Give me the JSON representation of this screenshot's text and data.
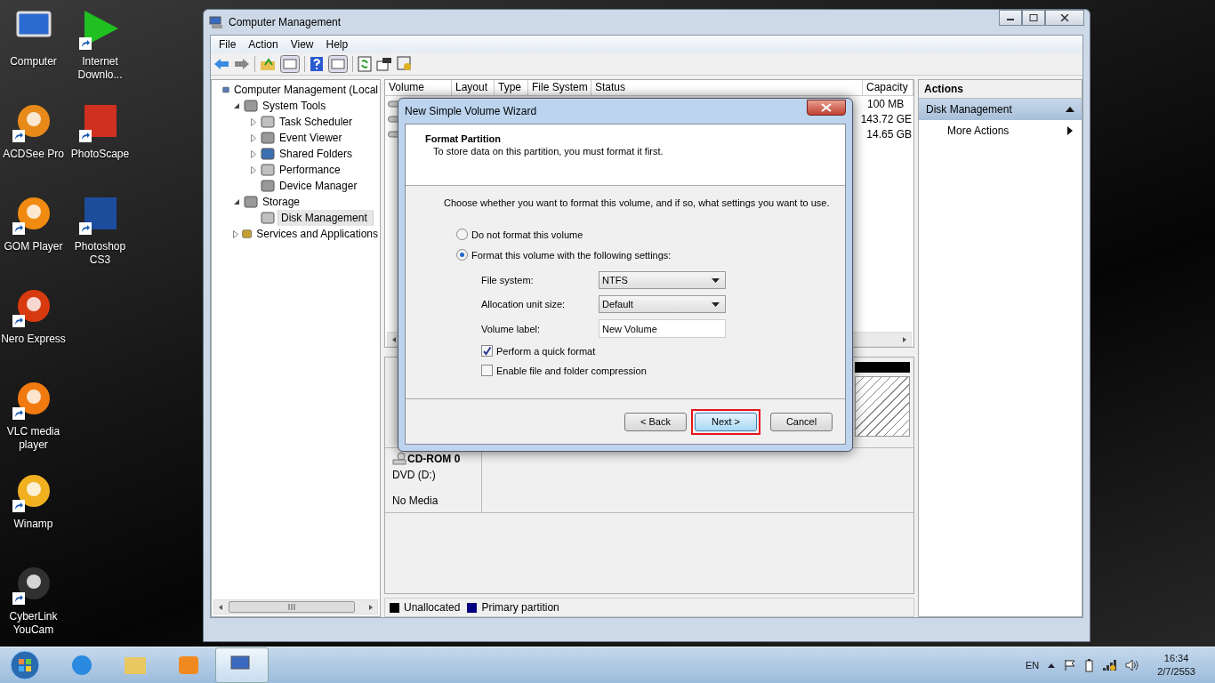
{
  "desktop": {
    "columns": [
      {
        "icons": [
          {
            "label": "Computer",
            "shortcut": false
          },
          {
            "label": "ACDSee Pro",
            "shortcut": true
          },
          {
            "label": "GOM Player",
            "shortcut": true
          },
          {
            "label": "Nero Express",
            "shortcut": true
          },
          {
            "label": "VLC media player",
            "shortcut": true
          },
          {
            "label": "Winamp",
            "shortcut": true
          },
          {
            "label": "CyberLink YouCam",
            "shortcut": true
          }
        ]
      },
      {
        "icons": [
          {
            "label": "Internet Downlo...",
            "shortcut": true
          },
          {
            "label": "PhotoScape",
            "shortcut": true
          },
          {
            "label": "Photoshop CS3",
            "shortcut": true
          }
        ]
      }
    ]
  },
  "window": {
    "title": "Computer Management",
    "menu": [
      "File",
      "Action",
      "View",
      "Help"
    ]
  },
  "tree": [
    {
      "label": "Computer Management (Local",
      "selected": false,
      "children": [
        {
          "label": "System Tools",
          "expanded": true,
          "selected": false,
          "children": [
            {
              "label": "Task Scheduler",
              "expanded": false,
              "selected": false
            },
            {
              "label": "Event Viewer",
              "expanded": false,
              "selected": false
            },
            {
              "label": "Shared Folders",
              "expanded": false,
              "selected": false
            },
            {
              "label": "Performance",
              "expanded": false,
              "selected": false
            },
            {
              "label": "Device Manager",
              "selected": false
            }
          ]
        },
        {
          "label": "Storage",
          "expanded": true,
          "selected": false,
          "children": [
            {
              "label": "Disk Management",
              "selected": true
            }
          ]
        },
        {
          "label": "Services and Applications",
          "expanded": false,
          "selected": false
        }
      ]
    }
  ],
  "volumes": {
    "columns": [
      "Volume",
      "Layout",
      "Type",
      "File System",
      "Status",
      "Capacity"
    ],
    "rows": [
      {
        "capacity": "100 MB"
      },
      {
        "capacity": "143.72 GE"
      },
      {
        "capacity": "14.65 GB"
      }
    ]
  },
  "cdrom": {
    "name": "CD-ROM 0",
    "type": "DVD (D:)",
    "status": "No Media"
  },
  "legend": [
    {
      "label": "Unallocated",
      "color": "#000000"
    },
    {
      "label": "Primary partition",
      "color": "#000080"
    }
  ],
  "actions": {
    "title": "Actions",
    "section": "Disk Management",
    "items": [
      "More Actions"
    ]
  },
  "dialog": {
    "title": "New Simple Volume Wizard",
    "heading": "Format Partition",
    "subheading": "To store data on this partition, you must format it first.",
    "intro": "Choose whether you want to format this volume, and if so, what settings you want to use.",
    "options": [
      {
        "label": "Do not format this volume",
        "selected": false
      },
      {
        "label": "Format this volume with the following settings:",
        "selected": true
      }
    ],
    "fields": [
      {
        "kind": "select",
        "label": "File system:",
        "value": "NTFS"
      },
      {
        "kind": "select",
        "label": "Allocation unit size:",
        "value": "Default"
      },
      {
        "kind": "text",
        "label": "Volume label:",
        "value": "New Volume"
      }
    ],
    "checks": [
      {
        "label": "Perform a quick format",
        "checked": true
      },
      {
        "label": "Enable file and folder compression",
        "checked": false
      }
    ],
    "buttons": [
      {
        "label": "< Back",
        "highlighted": false
      },
      {
        "label": "Next >",
        "highlighted": true
      },
      {
        "label": "Cancel",
        "highlighted": false
      }
    ]
  },
  "taskbar": {
    "apps": [
      {
        "selected": false
      },
      {
        "selected": false
      },
      {
        "selected": false
      },
      {
        "selected": true
      }
    ],
    "language": "EN",
    "time": "16:34",
    "date": "2/7/2553"
  }
}
